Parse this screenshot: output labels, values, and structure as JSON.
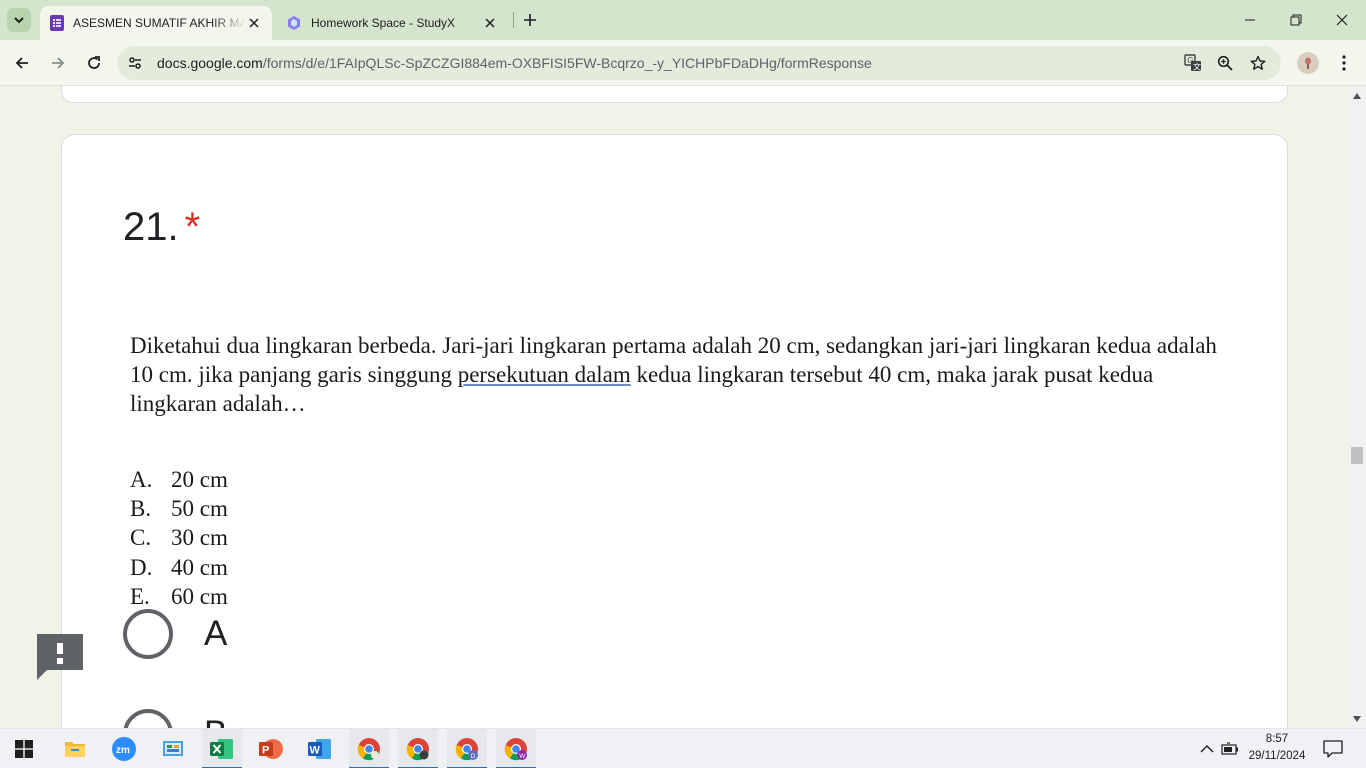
{
  "browser": {
    "tabs": [
      {
        "title": "ASESMEN SUMATIF AKHIR MAT",
        "active": true,
        "icon": "google-forms-icon"
      },
      {
        "title": "Homework Space - StudyX",
        "active": false,
        "icon": "studyx-icon"
      }
    ],
    "url_host": "docs.google.com",
    "url_path": "/forms/d/e/1FAIpQLSc-SpZCZGI884em-OXBFISI5FW-Bcqrzo_-y_YICHPbFDaDHg/formResponse"
  },
  "form": {
    "question_number": "21.",
    "required_marker": "*",
    "question_part1": "Diketahui dua lingkaran berbeda. Jari-jari lingkaran pertama adalah 20 cm, sedangkan jari-jari lingkaran kedua adalah 10 cm. jika panjang garis singgung ",
    "question_underlined": "persekutuan  dalam",
    "question_part2": " kedua lingkaran tersebut 40 cm, maka jarak pusat kedua lingkaran adalah…",
    "choices": [
      {
        "letter": "A.",
        "text": "20 cm"
      },
      {
        "letter": "B.",
        "text": "50 cm"
      },
      {
        "letter": "C.",
        "text": "30 cm"
      },
      {
        "letter": "D.",
        "text": "40 cm"
      },
      {
        "letter": "E.",
        "text": "60 cm"
      }
    ],
    "radio_options": [
      "A",
      "B"
    ]
  },
  "taskbar": {
    "apps": [
      "windows-start",
      "file-explorer",
      "zoom",
      "control-panel",
      "excel",
      "powerpoint",
      "word",
      "chrome",
      "chrome-profile-2",
      "chrome-profile-d",
      "chrome-profile-w"
    ],
    "time": "8:57",
    "date": "29/11/2024"
  },
  "colors": {
    "tab_strip": "#d4e5cd",
    "toolbar": "#f3f6ec",
    "page_bg": "#f1f3e6",
    "required": "#d93025",
    "forms_purple": "#673ab7"
  }
}
